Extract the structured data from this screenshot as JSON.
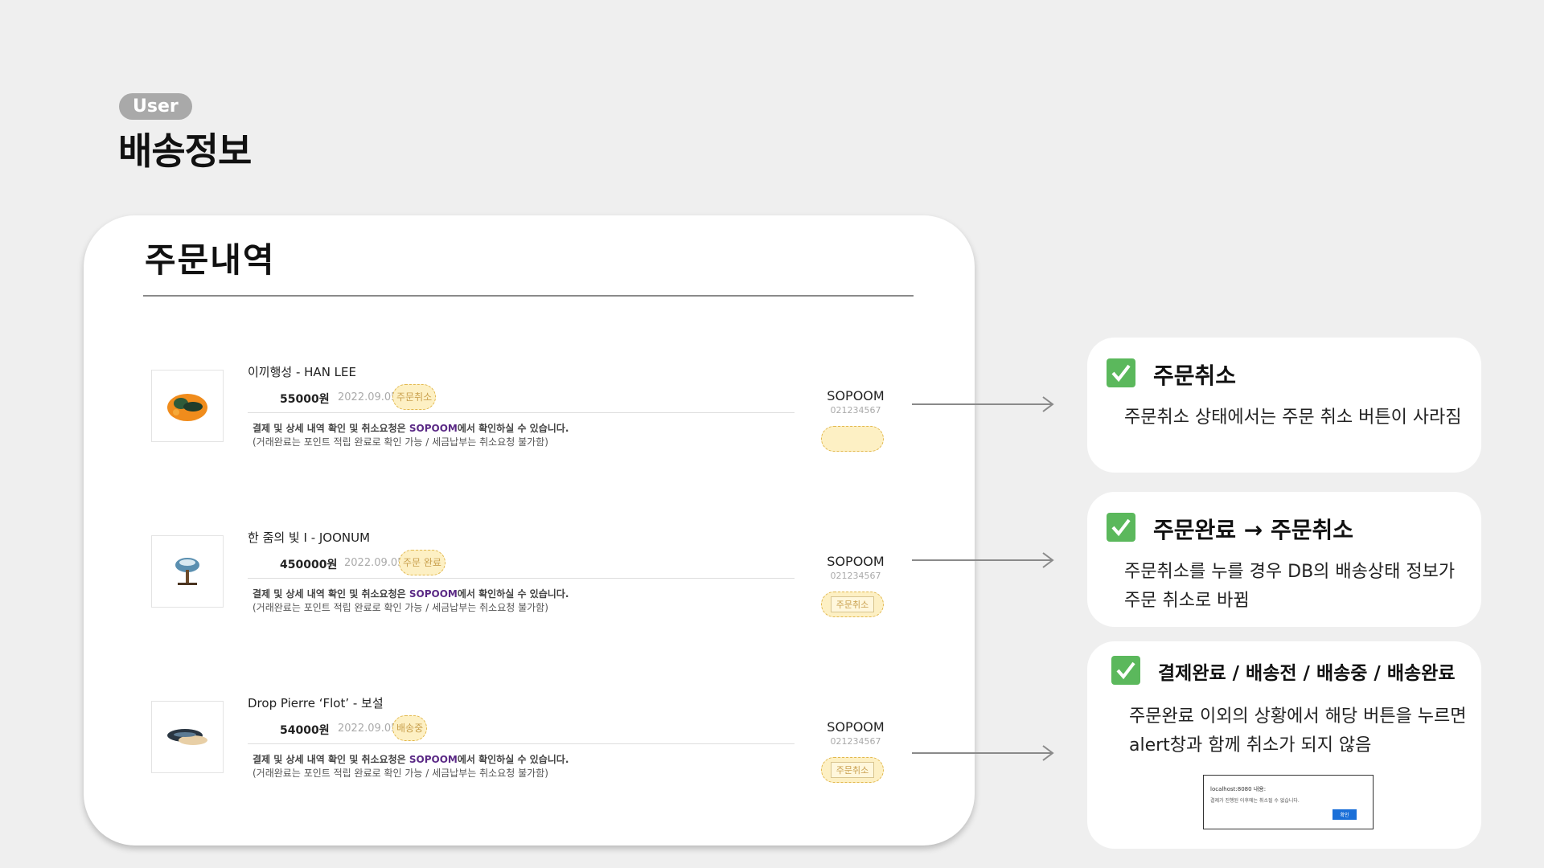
{
  "header": {
    "badge": "User",
    "title": "배송정보"
  },
  "card": {
    "title": "주문내역",
    "orders": [
      {
        "product": "이끼행성 - HAN LEE",
        "price": "55000원",
        "date": "2022.09.05",
        "status": "주문취소",
        "notice_prefix": "결제 및 상세 내역 확인 및 취소요청은 ",
        "notice_brand": "SOPOOM",
        "notice_suffix": "에서 확인하실 수 있습니다.",
        "notice_sub": "(거래완료는 포인트 적립 완료로 확인 가능 / 세금납부는 취소요청 불가함)",
        "seller": "SOPOOM",
        "seller_code": "021234567",
        "cancel_label": ""
      },
      {
        "product": "한 줌의 빛 I - JOONUM",
        "price": "450000원",
        "date": "2022.09.05",
        "status": "주문 완료",
        "notice_prefix": "결제 및 상세 내역 확인 및 취소요청은 ",
        "notice_brand": "SOPOOM",
        "notice_suffix": "에서 확인하실 수 있습니다.",
        "notice_sub": "(거래완료는 포인트 적립 완료로 확인 가능 / 세금납부는 취소요청 불가함)",
        "seller": "SOPOOM",
        "seller_code": "021234567",
        "cancel_label": "주문취소"
      },
      {
        "product": "Drop Pierre ‘Flot’ - 보설",
        "price": "54000원",
        "date": "2022.09.05",
        "status": "배송중",
        "notice_prefix": "결제 및 상세 내역 확인 및 취소요청은 ",
        "notice_brand": "SOPOOM",
        "notice_suffix": "에서 확인하실 수 있습니다.",
        "notice_sub": "(거래완료는 포인트 적립 완료로 확인 가능 / 세금납부는 취소요청 불가함)",
        "seller": "SOPOOM",
        "seller_code": "021234567",
        "cancel_label": "주문취소"
      }
    ]
  },
  "panels": [
    {
      "title": "주문취소",
      "body": [
        "주문취소 상태에서는 주문 취소 버튼이 사라짐"
      ]
    },
    {
      "title": "주문완료 → 주문취소",
      "body": [
        "주문취소를 누를 경우 DB의 배송상태 정보가",
        "주문 취소로 바뀜"
      ]
    },
    {
      "title": "결제완료 / 배송전 / 배송중 / 배송완료",
      "body": [
        "주문완료 이외의 상황에서 해당 버튼을 누르면",
        "alert창과 함께 취소가 되지 않음"
      ],
      "alert": {
        "title": "localhost:8080 내용:",
        "message": "결제가 진행된 이후에는 취소될 수 없습니다.",
        "button": "확인"
      }
    }
  ],
  "colors": {
    "background": "#efefef",
    "check": "#5bb85c",
    "highlight": "#fdf0c4",
    "brand": "#5b2a86"
  }
}
